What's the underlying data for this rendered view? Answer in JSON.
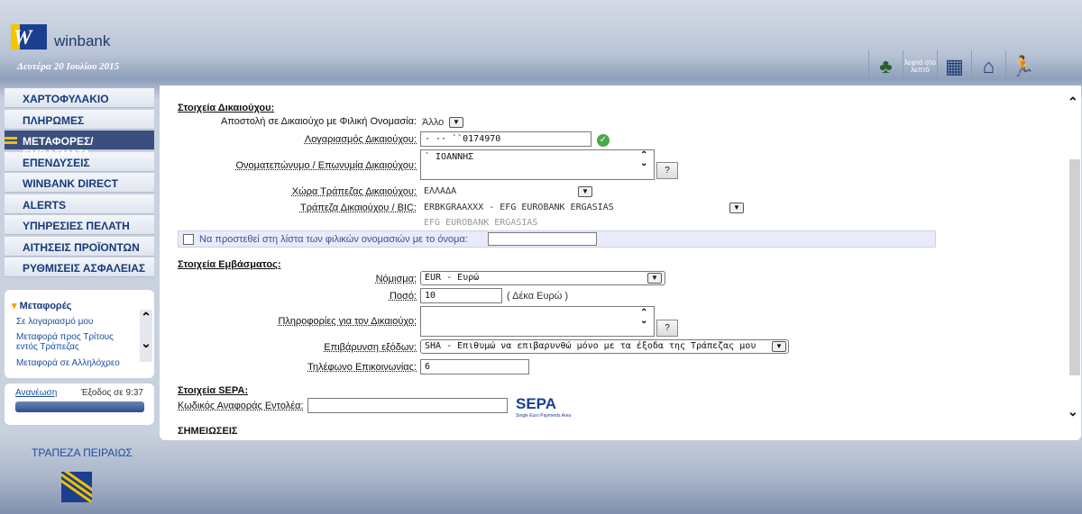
{
  "header": {
    "brand": "winbank",
    "date": "Δευτέρα 20 Ιουλίου 2015",
    "icons": [
      "tree-icon",
      "leaf-text-icon",
      "calculator-icon",
      "home-icon",
      "logout-runner-icon"
    ],
    "leaf_text": "λεφτά στο λεπτό"
  },
  "nav": {
    "items": [
      {
        "label": "ΧΑΡΤΟΦΥΛΑΚΙΟ"
      },
      {
        "label": "ΠΛΗΡΩΜΕΣ"
      },
      {
        "label": "ΜΕΤΑΦΟΡΕΣ/ΕΜΒΑΣΜΑΤΑ"
      },
      {
        "label": "ΕΠΕΝΔΥΣΕΙΣ"
      },
      {
        "label": "WINBANK DIRECT"
      },
      {
        "label": "ALERTS"
      },
      {
        "label": "ΥΠΗΡΕΣΙΕΣ ΠΕΛΑΤΗ"
      },
      {
        "label": "ΑΙΤΗΣΕΙΣ ΠΡΟΪΟΝΤΩΝ"
      },
      {
        "label": "ΡΥΘΜΙΣΕΙΣ ΑΣΦΑΛΕΙΑΣ"
      }
    ],
    "active": "ΜΕΤΑΦΟΡΕΣ/ΕΜΒΑΣΜΑΤΑ"
  },
  "transfers_box": {
    "title": "Μεταφορές",
    "links": [
      "Σε λογαριασμό μου",
      "Μεταφορά προς Τρίτους εντός Τράπεζας",
      "Μεταφορά σε Αλλ​ηλόχρεο"
    ]
  },
  "session": {
    "refresh": "Ανανέωση",
    "exit": "Έξοδος σε 9:37"
  },
  "footer": {
    "bank_name": "ΤΡΑΠΕΖΑ ΠΕΙΡΑΙΩΣ"
  },
  "form": {
    "beneficiary_section": "Στοιχεία Δικαιούχου:",
    "friendly_name_label": "Αποστολή σε Δικαιούχο με Φιλική Ονομασία:",
    "friendly_name_value": "Άλλο",
    "account_label": "Λογαριασμός Δικαιούχου:",
    "account_value": "   ·          ··        ``0174970",
    "name_label": "Ονοματεπώνυμο / Επωνυμία Δικαιούχου:",
    "name_value": "`                    ΙΟΑΝΝΗΣ",
    "help_label": "?",
    "country_label": "Χώρα Τράπεζας Δικαιούχου:",
    "country_value": "ΕΛΛΑΔΑ",
    "bank_label": "Τράπεζα Δικαιούχου / BIC:",
    "bank_value": "ERBKGRAAXXX - EFG EUROBANK ERGASIAS",
    "bank_name": "EFG EUROBANK ERGASIAS",
    "add_friendly_label": "Να προστεθεί στη λίστα των φιλικών ονομασιών με το όνομα:",
    "transfer_section": "Στοιχεία Εμβάσματος:",
    "currency_label": "Νόμισμα:",
    "currency_value": "EUR - Ευρώ",
    "amount_label": "Ποσό:",
    "amount_value": "10",
    "amount_words": "( Δέκα Ευρώ )",
    "info_label": "Πληροφορίες για τον Δικαιούχο:",
    "charges_label": "Επιβάρυνση εξόδων:",
    "charges_value": "SHA - Επιθυμώ να επιβαρυνθώ μόνο με τα έξοδα της Τράπεζας μου",
    "phone_label": "Τηλέφωνο Επικοινωνίας:",
    "phone_value": "6",
    "sepa_section": "Στοιχεία SEPA:",
    "sepa_ref_label": "Κωδικός Αναφοράς Εντολέα:",
    "sepa_logo": "SEPA",
    "sepa_tagline": "Single Euro Payments Area",
    "next_section": "ΣΗΜΕΙΩΣΕΙΣ"
  }
}
